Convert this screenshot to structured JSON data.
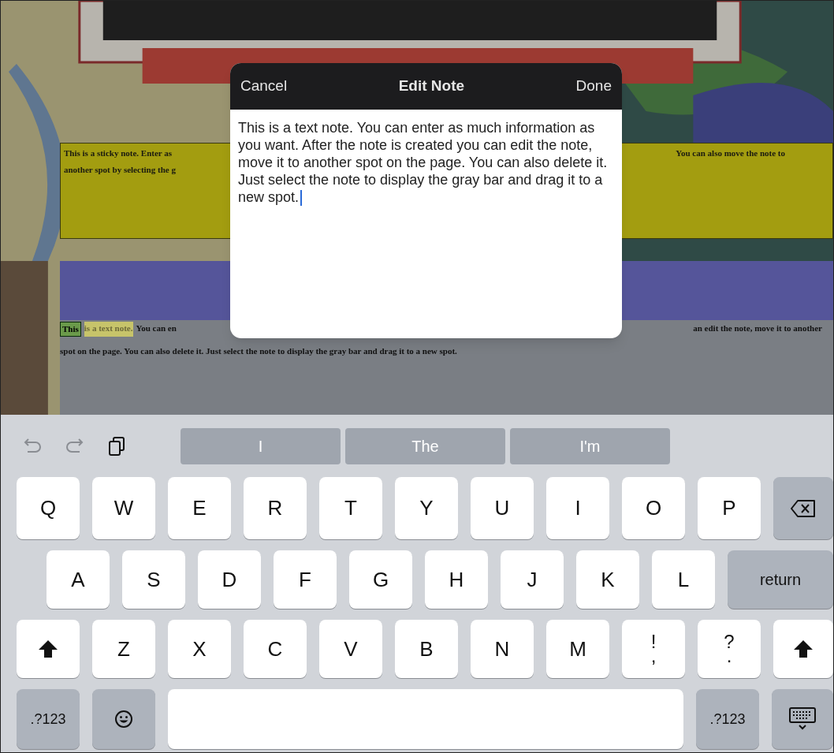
{
  "sticky_note": {
    "left_lines": [
      "This is a sticky note. Enter as",
      "another spot by selecting the g"
    ],
    "right_lines": [
      "You can also move the note to"
    ]
  },
  "text_note": {
    "line_1_left": [
      {
        "text": "This",
        "kind": "selected"
      },
      {
        "text": "is a text note.",
        "kind": "highlighted"
      },
      {
        "text": "You can en",
        "kind": "plain"
      }
    ],
    "line_1_right": "an edit the note, move it to another",
    "line_2": "spot on the page. You can also delete it. Just select the note to display the gray bar and drag it to a new spot."
  },
  "dialog": {
    "cancel": "Cancel",
    "title": "Edit Note",
    "done": "Done",
    "value": "This is a text note. You can enter as much information as you want. After the note is created you can edit the note, move it to another spot on the page. You can also delete it. Just select the note to display the gray bar and drag it to a new spot."
  },
  "keyboard": {
    "suggestions": [
      "I",
      "The",
      "I'm"
    ],
    "letter_rows": [
      [
        {
          "kind": "letter",
          "label": "Q"
        },
        {
          "kind": "letter",
          "label": "W"
        },
        {
          "kind": "letter",
          "label": "E"
        },
        {
          "kind": "letter",
          "label": "R"
        },
        {
          "kind": "letter",
          "label": "T"
        },
        {
          "kind": "letter",
          "label": "Y"
        },
        {
          "kind": "letter",
          "label": "U"
        },
        {
          "kind": "letter",
          "label": "I"
        },
        {
          "kind": "letter",
          "label": "O"
        },
        {
          "kind": "letter",
          "label": "P"
        },
        {
          "kind": "backspace"
        }
      ],
      [
        {
          "kind": "letter",
          "label": "A"
        },
        {
          "kind": "letter",
          "label": "S"
        },
        {
          "kind": "letter",
          "label": "D"
        },
        {
          "kind": "letter",
          "label": "F"
        },
        {
          "kind": "letter",
          "label": "G"
        },
        {
          "kind": "letter",
          "label": "H"
        },
        {
          "kind": "letter",
          "label": "J"
        },
        {
          "kind": "letter",
          "label": "K"
        },
        {
          "kind": "letter",
          "label": "L"
        },
        {
          "kind": "return",
          "label": "return"
        }
      ],
      [
        {
          "kind": "shift"
        },
        {
          "kind": "letter",
          "label": "Z"
        },
        {
          "kind": "letter",
          "label": "X"
        },
        {
          "kind": "letter",
          "label": "C"
        },
        {
          "kind": "letter",
          "label": "V"
        },
        {
          "kind": "letter",
          "label": "B"
        },
        {
          "kind": "letter",
          "label": "N"
        },
        {
          "kind": "letter",
          "label": "M"
        },
        {
          "kind": "punct",
          "label": "!",
          "sub": ","
        },
        {
          "kind": "punct",
          "label": "?",
          "sub": "."
        },
        {
          "kind": "shift"
        }
      ]
    ],
    "bottom_row": {
      "left_mode": ".?123",
      "right_mode": ".?123"
    }
  }
}
